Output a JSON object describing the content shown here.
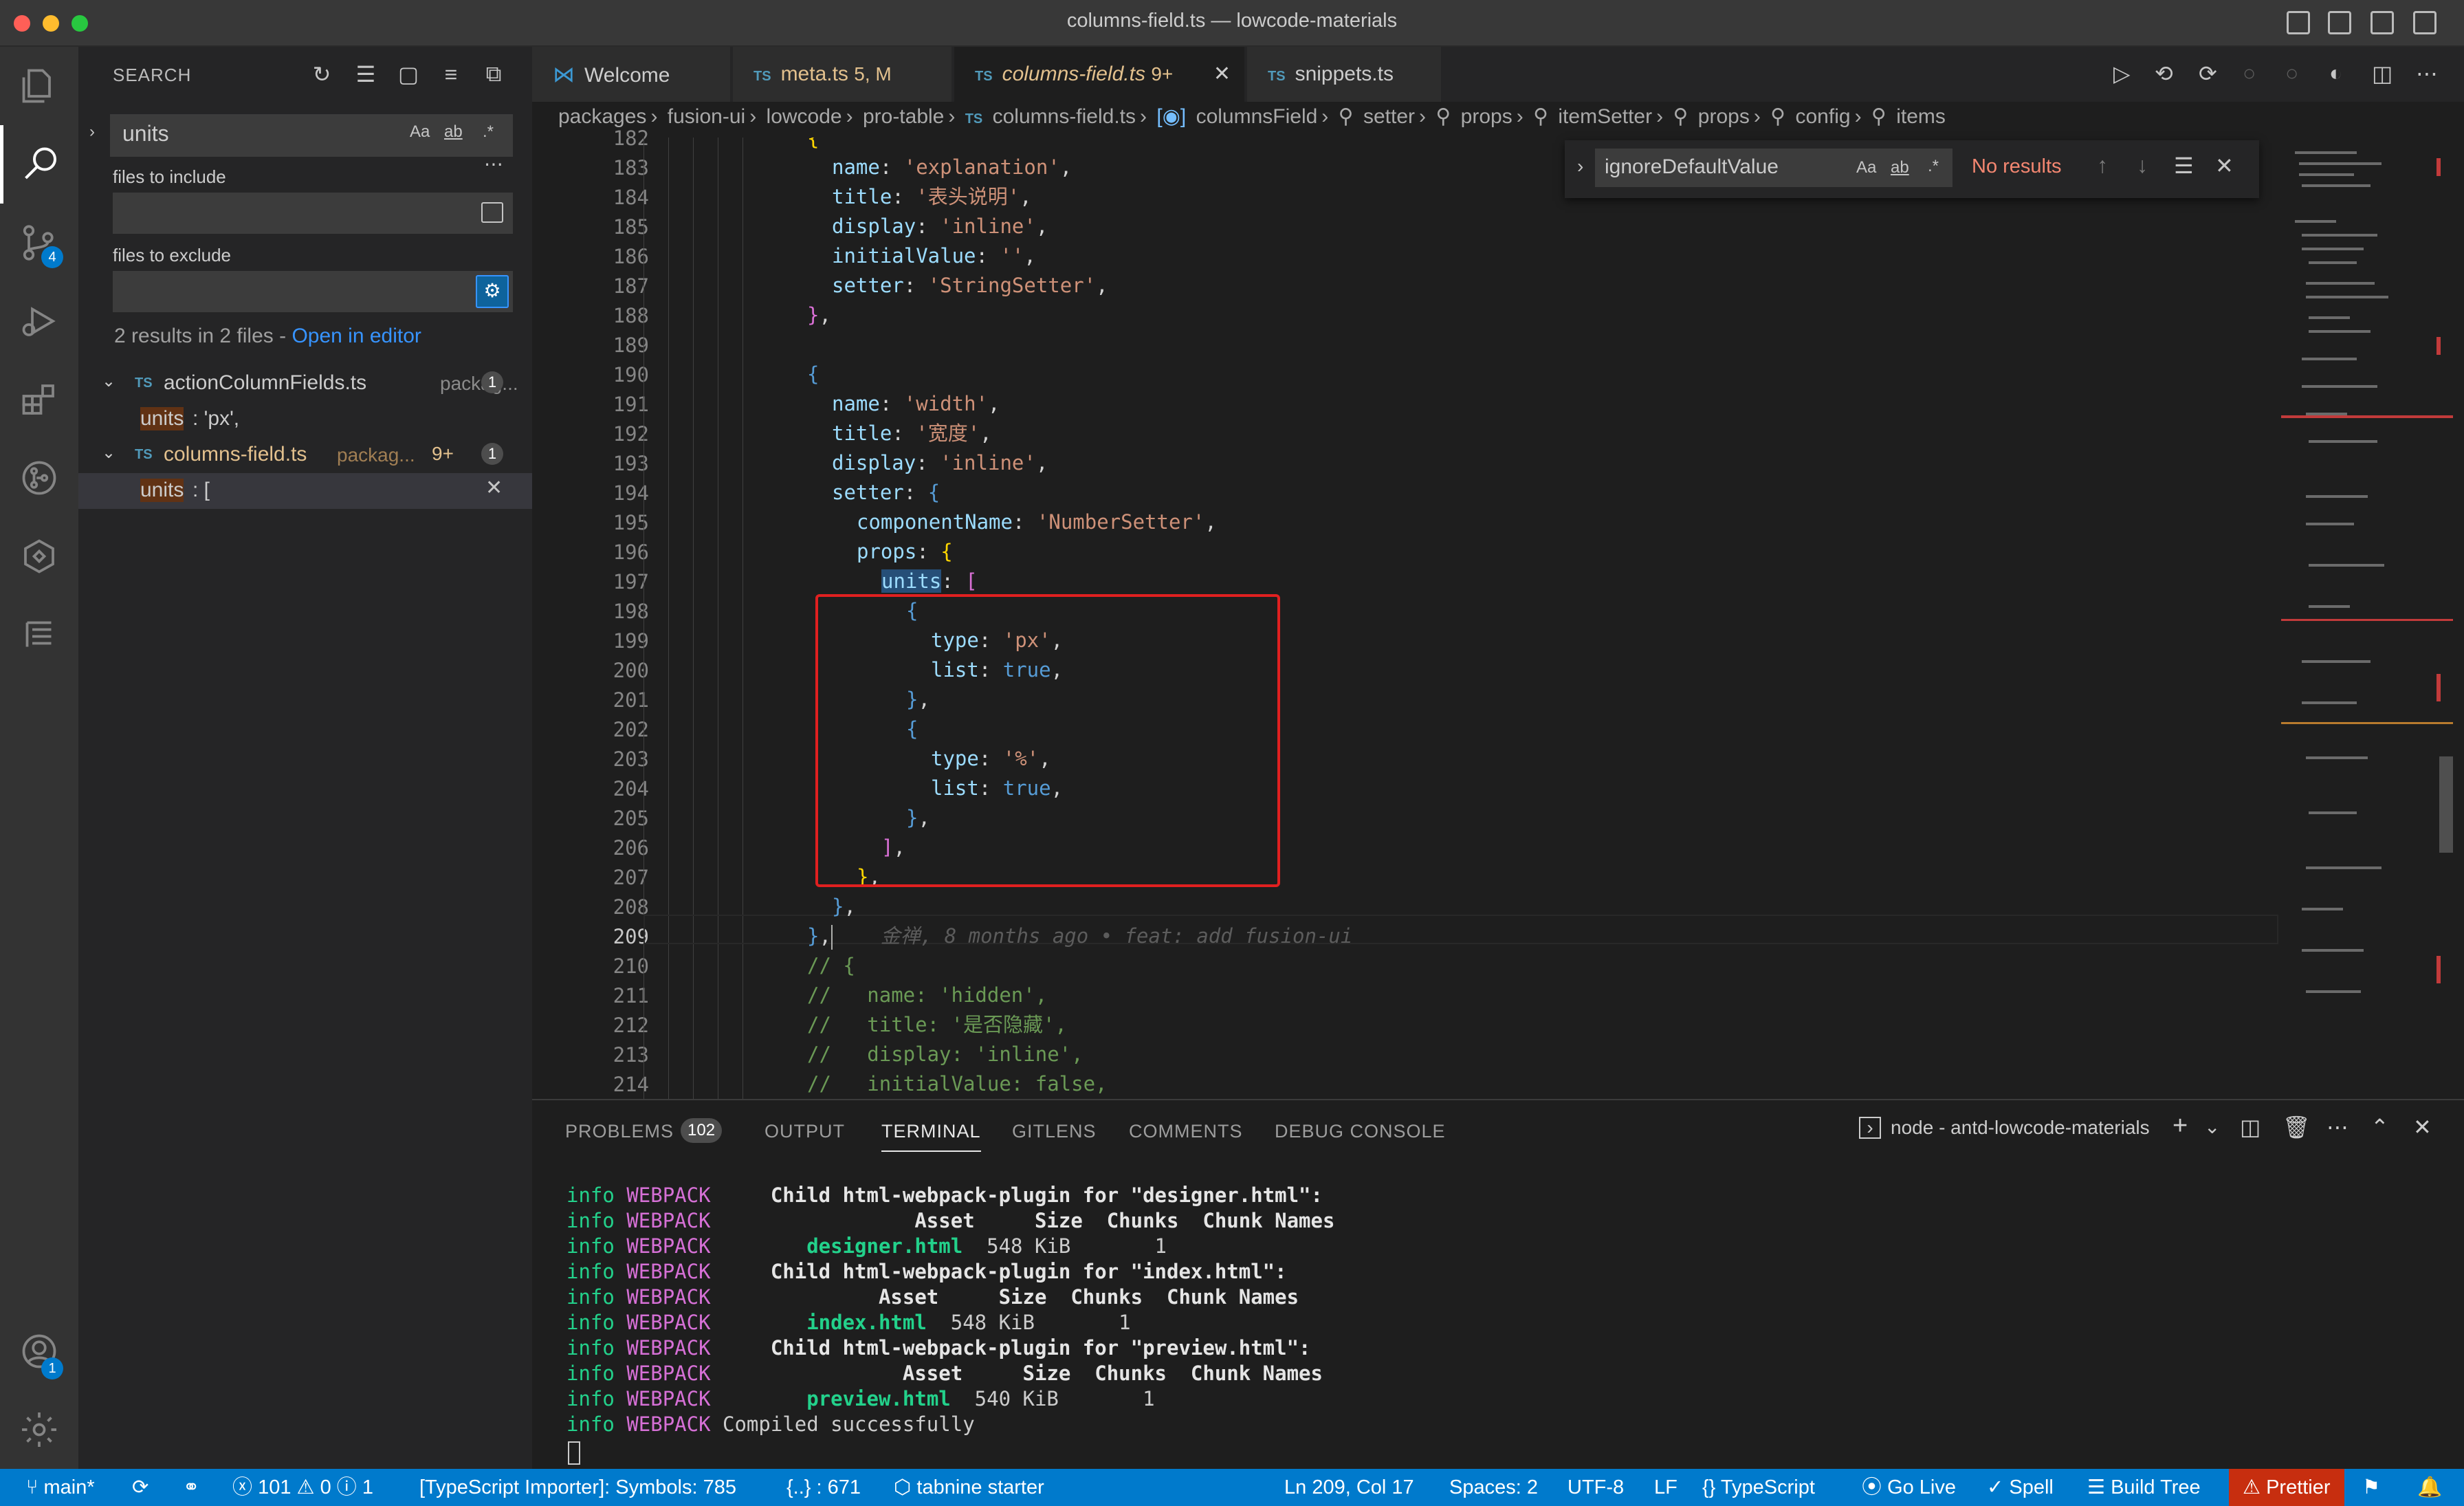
{
  "window": {
    "title": "columns-field.ts — lowcode-materials"
  },
  "sidebar": {
    "title": "SEARCH",
    "search_value": "units",
    "include_label": "files to include",
    "exclude_label": "files to exclude",
    "summary": "2 results in 2 files - ",
    "open_in_editor": "Open in editor",
    "files": [
      {
        "name": "actionColumnFields.ts",
        "path": "packag...",
        "count": "1",
        "match_pre": "units",
        "match_post": ": 'px',"
      },
      {
        "name": "columns-field.ts",
        "path": "packag...",
        "extra": "9+",
        "count": "1",
        "match_pre": "units",
        "match_post": ": ["
      }
    ],
    "option_icons": [
      "Aa",
      "ab",
      ".*"
    ]
  },
  "activity": {
    "scm_badge": "4",
    "account_badge": "1"
  },
  "tabs": [
    {
      "label": "Welcome"
    },
    {
      "label": "meta.ts",
      "suffix": "5, M"
    },
    {
      "label": "columns-field.ts",
      "suffix": "9+"
    },
    {
      "label": "snippets.ts"
    }
  ],
  "breadcrumbs": [
    "packages",
    "fusion-ui",
    "lowcode",
    "pro-table",
    "columns-field.ts",
    "columnsField",
    "setter",
    "props",
    "itemSetter",
    "props",
    "config",
    "items"
  ],
  "find": {
    "value": "ignoreDefaultValue",
    "result": "No results",
    "opt1": "Aa",
    "opt2": "ab",
    "opt3": ".*"
  },
  "editor": {
    "lines": [
      "182",
      "183",
      "184",
      "185",
      "186",
      "187",
      "188",
      "189",
      "190",
      "191",
      "192",
      "193",
      "194",
      "195",
      "196",
      "197",
      "198",
      "199",
      "200",
      "201",
      "202",
      "203",
      "204",
      "205",
      "206",
      "207",
      "208",
      "209",
      "210",
      "211",
      "212",
      "213",
      "214"
    ],
    "blame": "金禅, 8 months ago • feat: add fusion-ui",
    "code": {
      "l183_key": "name",
      "l183_val": "'explanation'",
      "l184_key": "title",
      "l184_val": "'表头说明'",
      "l185_key": "display",
      "l185_val": "'inline'",
      "l186_key": "initialValue",
      "l186_val": "''",
      "l187_key": "setter",
      "l187_val": "'StringSetter'",
      "l191_key": "name",
      "l191_val": "'width'",
      "l192_key": "title",
      "l192_val": "'宽度'",
      "l193_key": "display",
      "l193_val": "'inline'",
      "l194_key": "setter",
      "l195_key": "componentName",
      "l195_val": "'NumberSetter'",
      "l196_key": "props",
      "l197_key": "units",
      "l199_key": "type",
      "l199_val": "'px'",
      "l200_key": "list",
      "l200_val": "true",
      "l203_key": "type",
      "l203_val": "'%'",
      "l204_key": "list",
      "l204_val": "true",
      "l210": "// {",
      "l211": "//   name: 'hidden',",
      "l212": "//   title: '是否隐藏',",
      "l213": "//   display: 'inline',",
      "l214": "//   initialValue: false,"
    }
  },
  "panel": {
    "tabs": [
      "PROBLEMS",
      "OUTPUT",
      "TERMINAL",
      "GITLENS",
      "COMMENTS",
      "DEBUG CONSOLE"
    ],
    "problems_count": "102",
    "terminal_name": "node - antd-lowcode-materials",
    "log_prefix": "info",
    "log_tag": "WEBPACK",
    "lines": [
      {
        "text": "    Child html-webpack-plugin for \"designer.html\":"
      },
      {
        "text": "                Asset     Size  Chunks  Chunk Names"
      },
      {
        "file": "designer.html",
        "rest": "  548 KiB       1"
      },
      {
        "text": "    Child html-webpack-plugin for \"index.html\":"
      },
      {
        "text": "             Asset     Size  Chunks  Chunk Names"
      },
      {
        "file": "index.html",
        "rest": "  548 KiB       1"
      },
      {
        "text": "    Child html-webpack-plugin for \"preview.html\":"
      },
      {
        "text": "               Asset     Size  Chunks  Chunk Names"
      },
      {
        "file": "preview.html",
        "rest": "  540 KiB       1"
      },
      {
        "text": "Compiled successfully"
      }
    ]
  },
  "status": {
    "branch": "main*",
    "errors": "101",
    "warnings": "0",
    "infos": "1",
    "importer": "[TypeScript Importer]: Symbols: 785",
    "braces": "{..} : 671",
    "tabnine": "tabnine starter",
    "position": "Ln 209, Col 17",
    "spaces": "Spaces: 2",
    "encoding": "UTF-8",
    "eol": "LF",
    "language": "TypeScript",
    "golive": "Go Live",
    "spell": "Spell",
    "buildtree": "Build Tree",
    "prettier": "Prettier"
  }
}
